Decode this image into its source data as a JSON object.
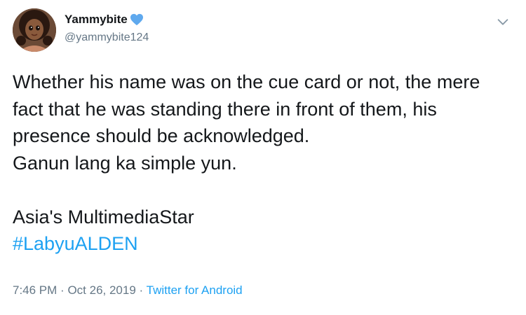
{
  "tweet": {
    "author": {
      "display_name": "Yammybite",
      "verified_emoji": "blue-heart",
      "handle": "@yammybite124"
    },
    "text_lines": [
      "Whether his name was on the cue card or not, the mere",
      "fact that he was standing there in front of them, his",
      "presence should be acknowledged.",
      "Ganun lang ka simple yun."
    ],
    "text_lines_2": [
      "Asia's MultimediaStar"
    ],
    "hashtag": "#LabyuALDEN",
    "time": "7:46 PM",
    "separator": "·",
    "date": "Oct 26, 2019",
    "source": "Twitter for Android"
  },
  "colors": {
    "link": "#1da1f2",
    "muted": "#657786",
    "text": "#14171a",
    "heart": "#5fa9ee"
  },
  "icons": {
    "menu": "chevron-down-icon",
    "heart": "blue-heart-icon"
  }
}
